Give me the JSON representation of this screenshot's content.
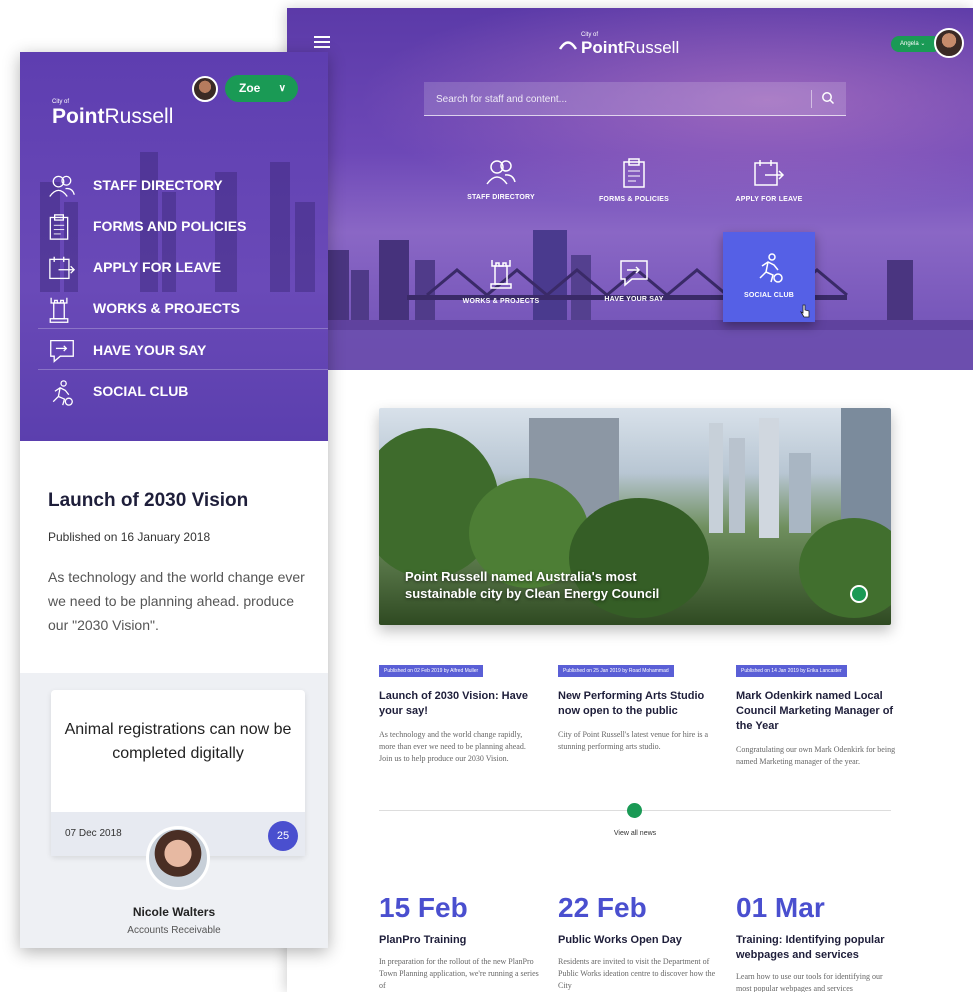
{
  "desktop": {
    "logo": {
      "city": "City of",
      "name_bold": "Point",
      "name_rest": "Russell"
    },
    "user": {
      "name": "Angela"
    },
    "search": {
      "placeholder": "Search for staff and content..."
    },
    "tiles": [
      {
        "label": "STAFF DIRECTORY",
        "icon": "people-icon"
      },
      {
        "label": "FORMS & POLICIES",
        "icon": "clipboard-icon"
      },
      {
        "label": "APPLY FOR LEAVE",
        "icon": "calendar-arrow-icon"
      },
      {
        "label": "WORKS & PROJECTS",
        "icon": "tower-icon"
      },
      {
        "label": "HAVE YOUR SAY",
        "icon": "speech-bubble-icon"
      },
      {
        "label": "SOCIAL CLUB",
        "icon": "runner-icon",
        "active": true
      }
    ],
    "feature": {
      "title": "Point Russell named Australia's most sustainable city by Clean Energy Council"
    },
    "news": [
      {
        "meta": "Published on 02 Feb 2019 by Alfred Muller",
        "title": "Launch of 2030 Vision: Have your say!",
        "body": "As technology and the world change rapidly, more than ever we need to be planning ahead. Join us to help produce our 2030 Vision."
      },
      {
        "meta": "Published on 25 Jan 2019 by Road Mohammad",
        "title": "New Performing Arts Studio now open to the public",
        "body": "City of Point Russell's latest venue for hire is a stunning performing arts studio."
      },
      {
        "meta": "Published on 14 Jan 2019 by Erika Lancaster",
        "title": "Mark Odenkirk named Local Council Marketing Manager of the Year",
        "body": "Congratulating our own Mark Odenkirk for being named Marketing manager of the year."
      }
    ],
    "view_all": "View all news",
    "events": [
      {
        "date": "15 Feb",
        "title": "PlanPro Training",
        "body": "In preparation for the rollout of the new PlanPro Town Planning application, we're running a series of"
      },
      {
        "date": "22 Feb",
        "title": "Public Works Open Day",
        "body": "Residents are invited to visit the Department of Public Works ideation centre to discover how the City"
      },
      {
        "date": "01 Mar",
        "title": "Training: Identifying popular webpages and services",
        "body": "Learn how to use our tools for identifying our most popular webpages and services"
      }
    ]
  },
  "mobile": {
    "logo": {
      "city": "City of",
      "name_bold": "Point",
      "name_rest": "Russell"
    },
    "user": {
      "name": "Zoe"
    },
    "nav": [
      {
        "label": "STAFF DIRECTORY",
        "icon": "people-icon"
      },
      {
        "label": "FORMS AND POLICIES",
        "icon": "clipboard-icon"
      },
      {
        "label": "APPLY FOR LEAVE",
        "icon": "calendar-arrow-icon"
      },
      {
        "label": "WORKS & PROJECTS",
        "icon": "tower-icon"
      },
      {
        "label": "HAVE YOUR SAY",
        "icon": "speech-bubble-icon"
      },
      {
        "label": "SOCIAL CLUB",
        "icon": "runner-icon"
      }
    ],
    "article": {
      "title": "Launch of 2030 Vision",
      "published": "Published on 16 January 2018",
      "body": "As technology and the world change ever we need to be planning ahead. produce our \"2030 Vision\"."
    },
    "card": {
      "headline": "Animal registrations can now be completed digitally",
      "date": "07 Dec 2018",
      "count": "25"
    },
    "person": {
      "name": "Nicole Walters",
      "role": "Accounts Receivable"
    }
  },
  "colors": {
    "purple": "#5e3eb0",
    "green": "#1a9a55",
    "accent": "#4a4fcf"
  }
}
